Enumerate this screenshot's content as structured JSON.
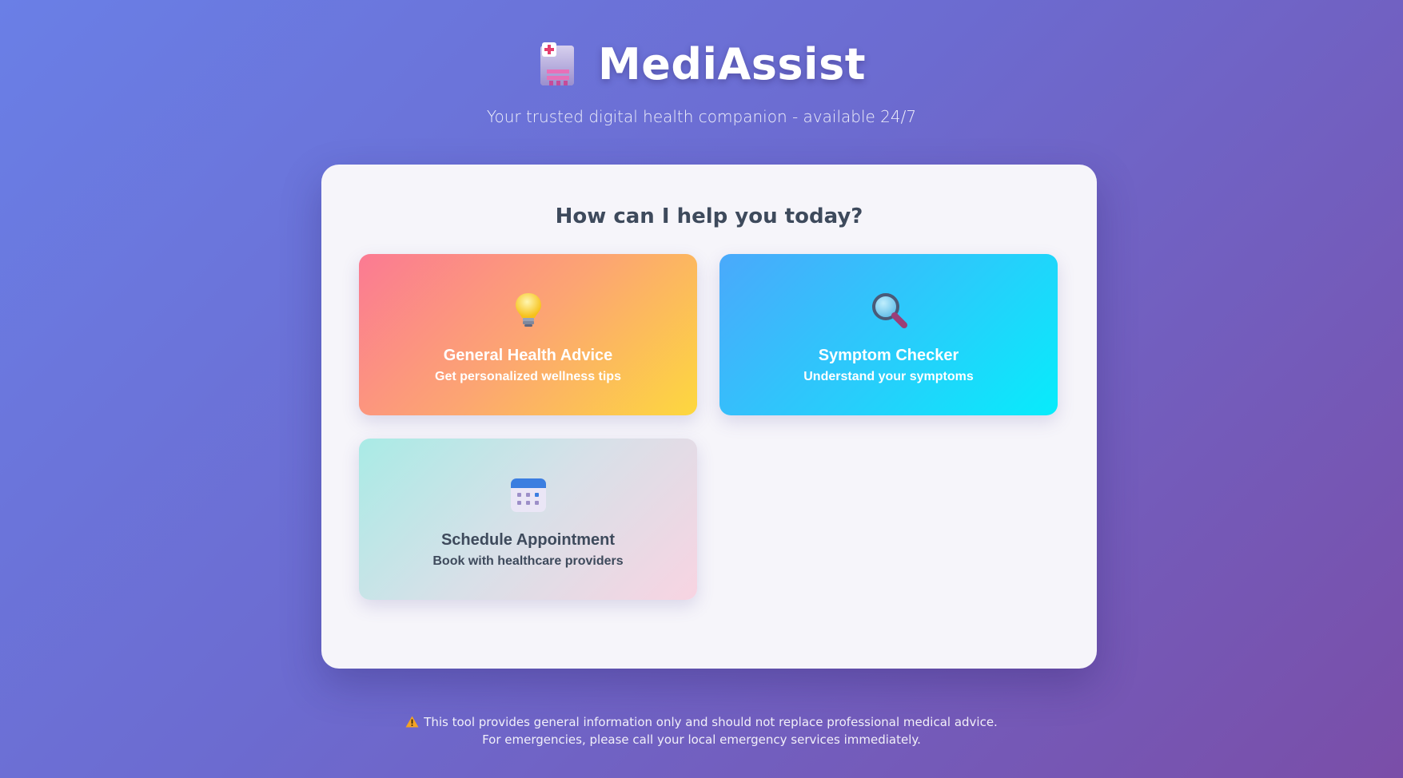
{
  "header": {
    "app_title": "MediAssist",
    "tagline": "Your trusted digital health companion - available 24/7",
    "logo_icon": "hospital-icon"
  },
  "main": {
    "heading": "How can I help you today?",
    "options": [
      {
        "title": "General Health Advice",
        "subtitle": "Get personalized wellness tips",
        "icon": "lightbulb-icon"
      },
      {
        "title": "Symptom Checker",
        "subtitle": "Understand your symptoms",
        "icon": "magnifying-glass-icon"
      },
      {
        "title": "Schedule Appointment",
        "subtitle": "Book with healthcare providers",
        "icon": "calendar-icon"
      }
    ]
  },
  "footer": {
    "line1": "This tool provides general information only and should not replace professional medical advice.",
    "line2": "For emergencies, please call your local emergency services immediately.",
    "icon": "warning-icon"
  },
  "colors": {
    "background_start": "#6a7fe6",
    "background_end": "#7a4ea8",
    "card_bg": "#f6f5fa",
    "heading_text": "#3e4a5c",
    "general_gradient": [
      "#fb7a93",
      "#fca572",
      "#fdd83e"
    ],
    "symptom_gradient": [
      "#4aa9fb",
      "#28cdfb",
      "#07ecfb"
    ],
    "schedule_gradient": [
      "#a9ebe6",
      "#d8e0e8",
      "#f8d4e2"
    ]
  }
}
